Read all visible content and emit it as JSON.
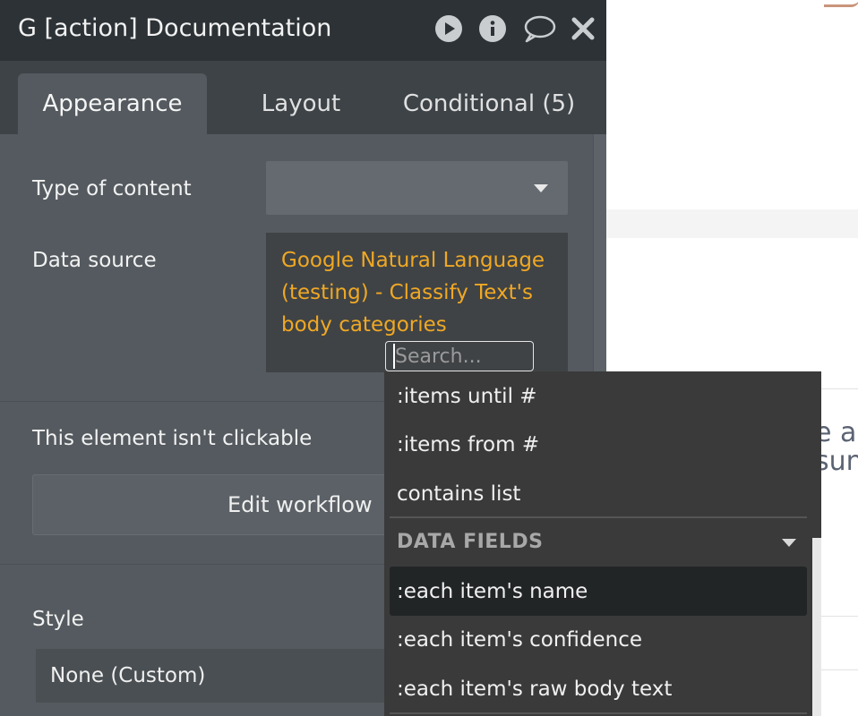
{
  "window": {
    "title": "G [action] Documentation",
    "icons": [
      "play-icon",
      "info-icon",
      "comment-icon",
      "close-icon"
    ]
  },
  "tabs": [
    {
      "label": "Appearance",
      "active": true
    },
    {
      "label": "Layout",
      "active": false
    },
    {
      "label": "Conditional (5)",
      "active": false
    }
  ],
  "fields": {
    "type_of_content_label": "Type of content",
    "type_of_content_value": "",
    "data_source_label": "Data source",
    "data_source_value": "Google Natural Language (testing) - Classify Text's body categories",
    "search_placeholder": "Search..."
  },
  "clickable": {
    "label": "This element isn't clickable",
    "edit_workflow": "Edit workflow"
  },
  "style": {
    "label": "Style",
    "value": "None (Custom)"
  },
  "dropdown": {
    "items_top": [
      ":items until #",
      ":items from #",
      "contains list"
    ],
    "section_label": "DATA FIELDS",
    "fields": [
      {
        "label": ":each item's name",
        "highlighted": true
      },
      {
        "label": ":each item's confidence",
        "highlighted": false
      },
      {
        "label": ":each item's raw body text",
        "highlighted": false
      }
    ]
  },
  "background": {
    "text_line1": "e a",
    "text_line2": "sun"
  },
  "colors": {
    "panel_bg": "#545a5f",
    "titlebar_bg": "#2c3236",
    "accent_orange": "#f0a824",
    "dropdown_bg": "#3a3a3a"
  }
}
